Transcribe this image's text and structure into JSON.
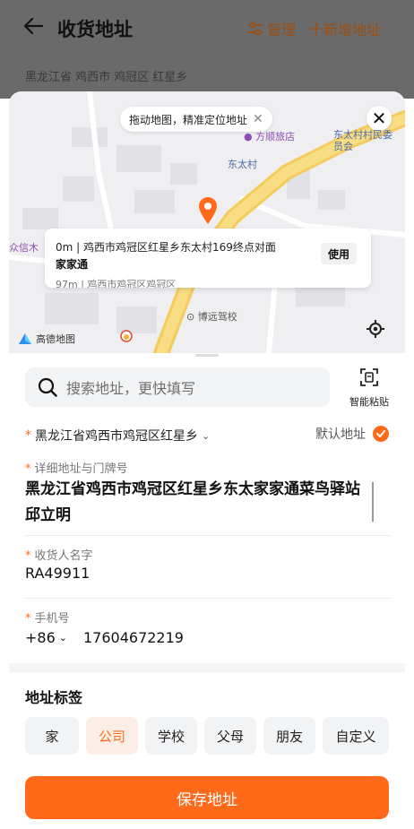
{
  "header": {
    "title": "收货地址",
    "manage_label": "管理",
    "add_label": "十新增地址",
    "region_text": "黑龙江省 鸡西市 鸡冠区 红星乡"
  },
  "map": {
    "tip_text": "拖动地图，精准定位地址",
    "pois": {
      "shop": "方顺旅店",
      "village": "东太村",
      "committee": "东太村村民委员会",
      "left_poi": "众信木",
      "school": "博远驾校"
    },
    "suggestion": {
      "line1": "0m | 鸡西市鸡冠区红星乡东太村169终点对面",
      "name": "家家通",
      "use_label": "使用",
      "line2": "97m | 鸡西市鸡冠区鸡冠区"
    },
    "logo_text": "高德地图"
  },
  "search": {
    "placeholder": "搜索地址，更快填写",
    "paste_label": "智能粘贴"
  },
  "form": {
    "region_value": "黑龙江省鸡西市鸡冠区红星乡",
    "default_label": "默认地址",
    "detail_label": "详细地址与门牌号",
    "detail_value": "黑龙江省鸡西市鸡冠区红星乡东太家家通菜鸟驿站邱立明",
    "name_label": "收货人名字",
    "name_value": "RA49911",
    "phone_label": "手机号",
    "country_code": "+86",
    "phone_value": "17604672219"
  },
  "tags": {
    "title": "地址标签",
    "items": [
      "家",
      "公司",
      "学校",
      "父母",
      "朋友",
      "自定义"
    ],
    "active": "公司"
  },
  "save_label": "保存地址",
  "colors": {
    "accent": "#ff6a1a",
    "overlay": "#6a6a6a",
    "manage_text": "#9b4e12"
  }
}
